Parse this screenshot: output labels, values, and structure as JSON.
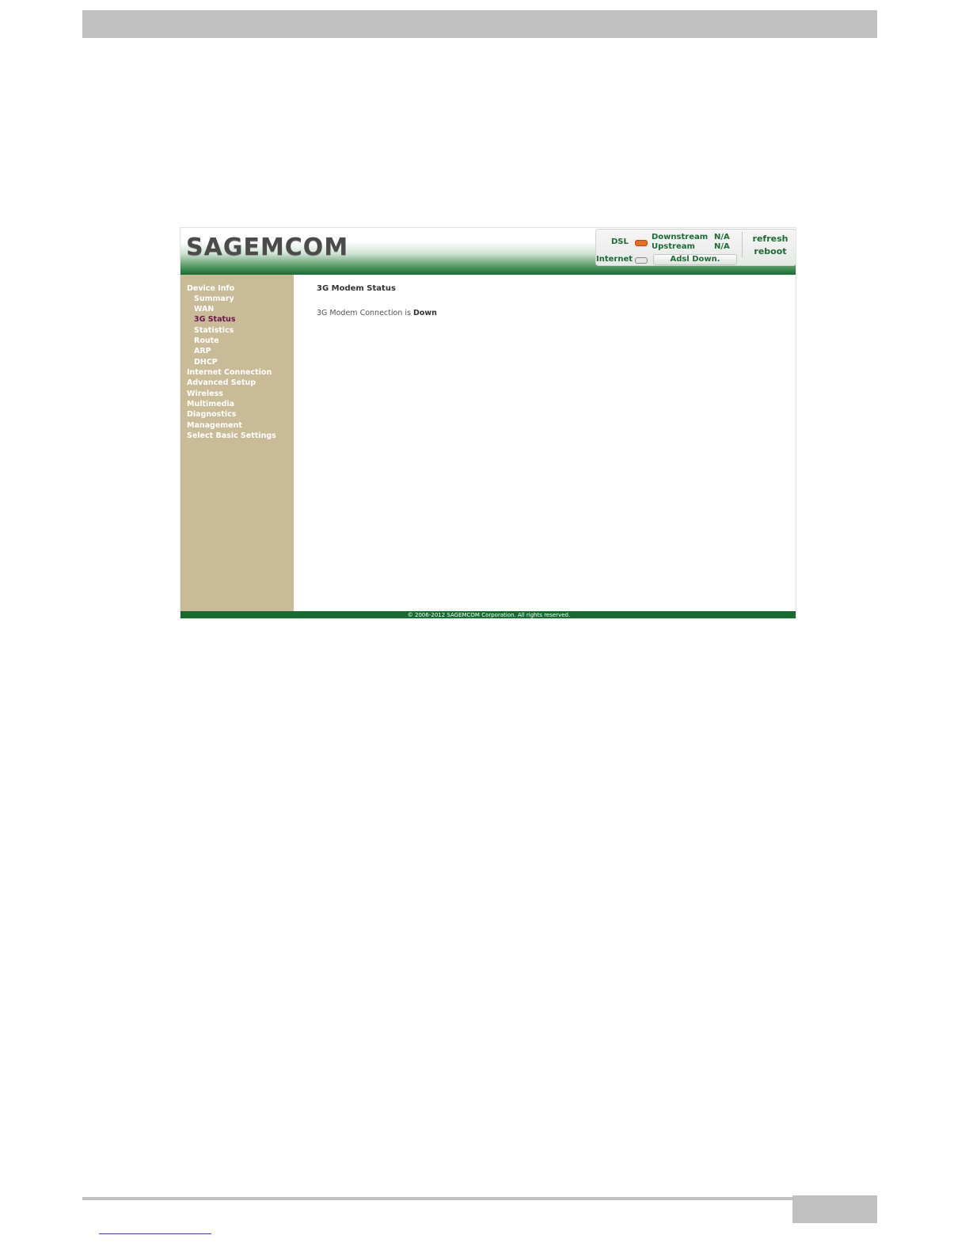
{
  "brand": {
    "logo_text": "SAGEMCOM"
  },
  "status_panel": {
    "dsl_label": "DSL",
    "internet_label": "Internet",
    "downstream_label": "Downstream",
    "upstream_label": "Upstream",
    "downstream_value": "N/A",
    "upstream_value": "N/A",
    "connection_status": "Adsl Down.",
    "refresh_label": "refresh",
    "reboot_label": "reboot",
    "dsl_led_color": "#ee6a20",
    "internet_led_color": "#e6e6e6"
  },
  "sidebar": {
    "items": [
      {
        "label": "Device Info",
        "level": 0
      },
      {
        "label": "Summary",
        "level": 1
      },
      {
        "label": "WAN",
        "level": 1
      },
      {
        "label": "3G Status",
        "level": 1,
        "active": true
      },
      {
        "label": "Statistics",
        "level": 1
      },
      {
        "label": "Route",
        "level": 1
      },
      {
        "label": "ARP",
        "level": 1
      },
      {
        "label": "DHCP",
        "level": 1
      },
      {
        "label": "Internet Connection",
        "level": 0
      },
      {
        "label": "Advanced Setup",
        "level": 0
      },
      {
        "label": "Wireless",
        "level": 0
      },
      {
        "label": "Multimedia",
        "level": 0
      },
      {
        "label": "Diagnostics",
        "level": 0
      },
      {
        "label": "Management",
        "level": 0
      },
      {
        "label": "Select Basic Settings",
        "level": 0
      }
    ]
  },
  "main": {
    "title": "3G Modem Status",
    "status_prefix": "3G Modem Connection is",
    "status_value": "Down"
  },
  "footer": {
    "copyright": "© 2006-2012 SAGEMCOM Corporation. All rights reserved."
  },
  "colors": {
    "header_green": "#176b30",
    "sidebar_bg": "#c9bb98",
    "active_nav": "#6b1550"
  }
}
